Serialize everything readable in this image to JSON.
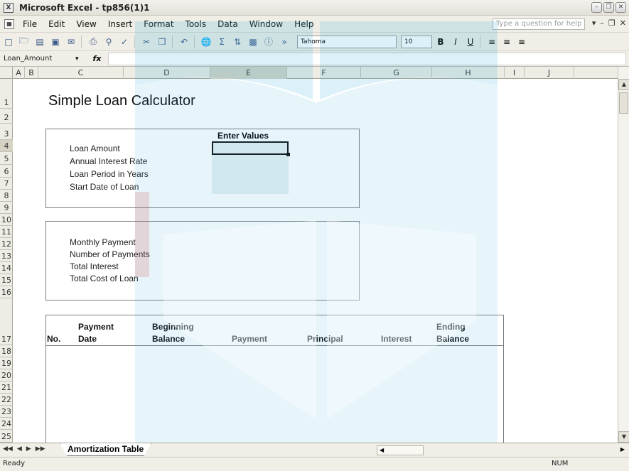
{
  "window": {
    "title": "Microsoft Excel - tp856(1)1",
    "app_icon": "X"
  },
  "menu": {
    "items": [
      "File",
      "Edit",
      "View",
      "Insert",
      "Format",
      "Tools",
      "Data",
      "Window",
      "Help"
    ],
    "help_placeholder": "Type a question for help"
  },
  "toolbar": {
    "font_name": "Tahoma",
    "font_size": "10",
    "bold": "B",
    "italic": "I",
    "underline": "U"
  },
  "formula_bar": {
    "name_box": "Loan_Amount",
    "fx": "fx"
  },
  "columns": [
    "A",
    "B",
    "C",
    "D",
    "E",
    "F",
    "G",
    "H",
    "I",
    "J"
  ],
  "rows": [
    "1",
    "2",
    "3",
    "4",
    "5",
    "6",
    "7",
    "8",
    "9",
    "10",
    "11",
    "12",
    "13",
    "14",
    "15",
    "16",
    "17",
    "18",
    "19",
    "20",
    "21",
    "22",
    "23",
    "24",
    "25"
  ],
  "sheet": {
    "title": "Simple Loan Calculator",
    "enter_values": "Enter Values",
    "input_labels": [
      "Loan Amount",
      "Annual Interest Rate",
      "Loan Period in Years",
      "Start Date of Loan"
    ],
    "output_labels": [
      "Monthly Payment",
      "Number of Payments",
      "Total Interest",
      "Total Cost of Loan"
    ],
    "table_headers": {
      "no": "No.",
      "payment_date_1": "Payment",
      "payment_date_2": "Date",
      "beginning_balance_1": "Beginning",
      "beginning_balance_2": "Balance",
      "payment": "Payment",
      "principal": "Principal",
      "interest": "Interest",
      "ending_balance_1": "Ending",
      "ending_balance_2": "Balance"
    }
  },
  "tabs": {
    "active": "Amortization Table"
  },
  "status": {
    "left": "Ready",
    "right": "NUM"
  },
  "colors": {
    "watermark": "#3aaed8",
    "watermark_red": "#c84a4a",
    "input_shade": "#e6f1f5",
    "chrome": "#f0eee6"
  }
}
